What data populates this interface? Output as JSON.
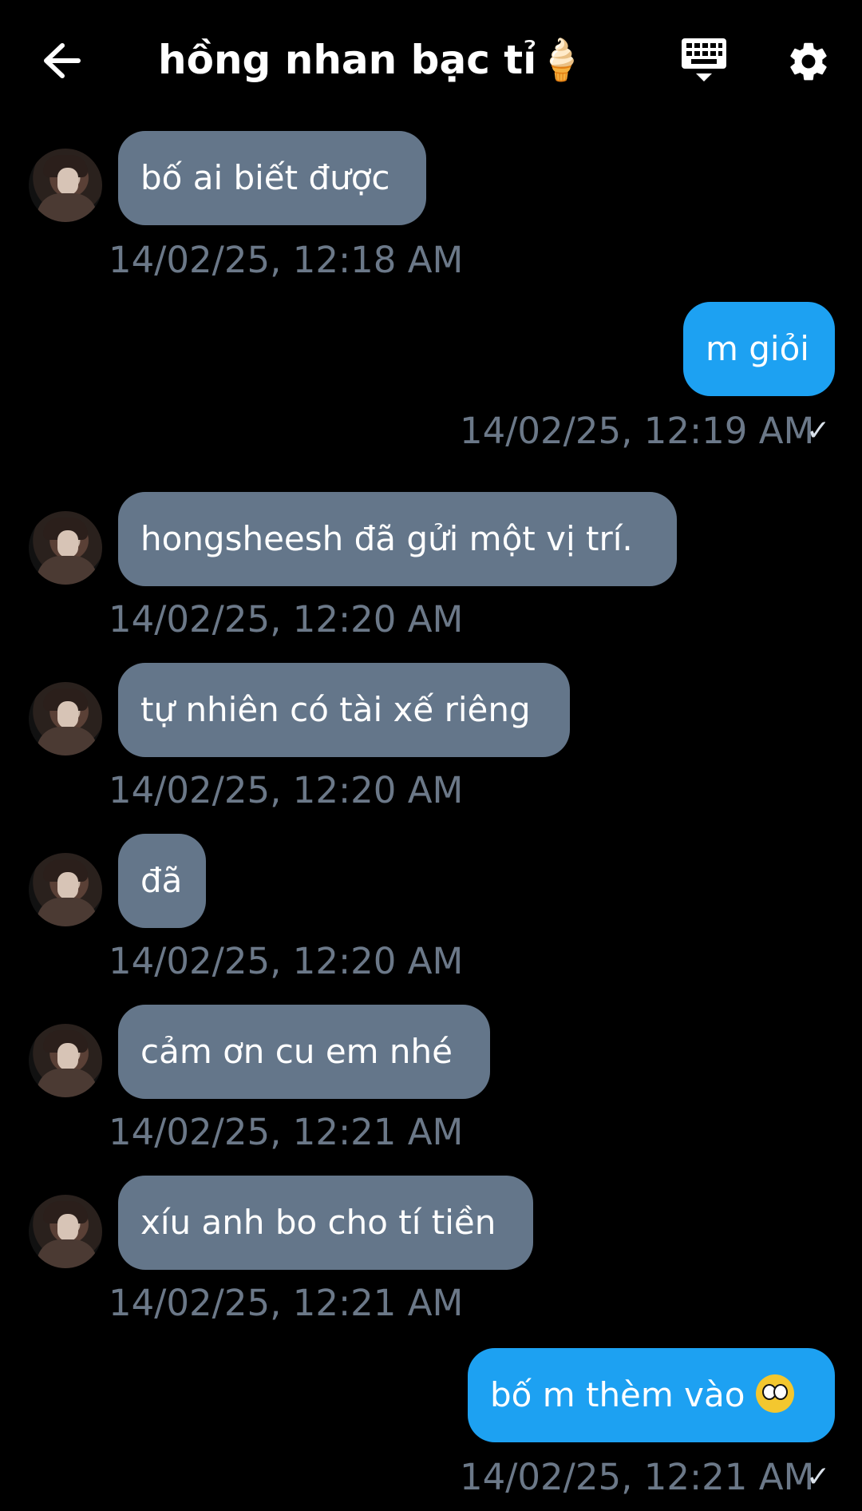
{
  "header": {
    "title": "hồng nhan bạc tỉ🍦",
    "back_icon": "back-arrow-icon",
    "keyboard_icon": "keyboard-icon",
    "settings_icon": "gear-icon"
  },
  "messages": [
    {
      "from": "other",
      "text": "bố ai biết được",
      "time": "14/02/25, 12:18 AM"
    },
    {
      "from": "me",
      "text": "m giỏi",
      "time": "14/02/25, 12:19 AM",
      "status": "✓"
    },
    {
      "from": "other",
      "text": "hongsheesh đã gửi một vị trí.",
      "time": "14/02/25, 12:20 AM"
    },
    {
      "from": "other",
      "text": "tự nhiên có tài xế riêng",
      "time": "14/02/25, 12:20 AM"
    },
    {
      "from": "other",
      "text": "đã",
      "time": "14/02/25, 12:20 AM"
    },
    {
      "from": "other",
      "text": "cảm ơn cu em nhé",
      "time": "14/02/25, 12:21 AM"
    },
    {
      "from": "other",
      "text": "xíu anh bo cho tí tiền",
      "time": "14/02/25, 12:21 AM"
    },
    {
      "from": "me",
      "text": "bố m thèm vào",
      "emoji": "face-with-rolling-eyes-emoji",
      "time": "14/02/25, 12:21 AM",
      "status": "✓"
    }
  ],
  "colors": {
    "incoming_bubble": "#64768a",
    "outgoing_bubble": "#1da1f2",
    "timestamp": "#6b7888",
    "background": "#000000"
  }
}
